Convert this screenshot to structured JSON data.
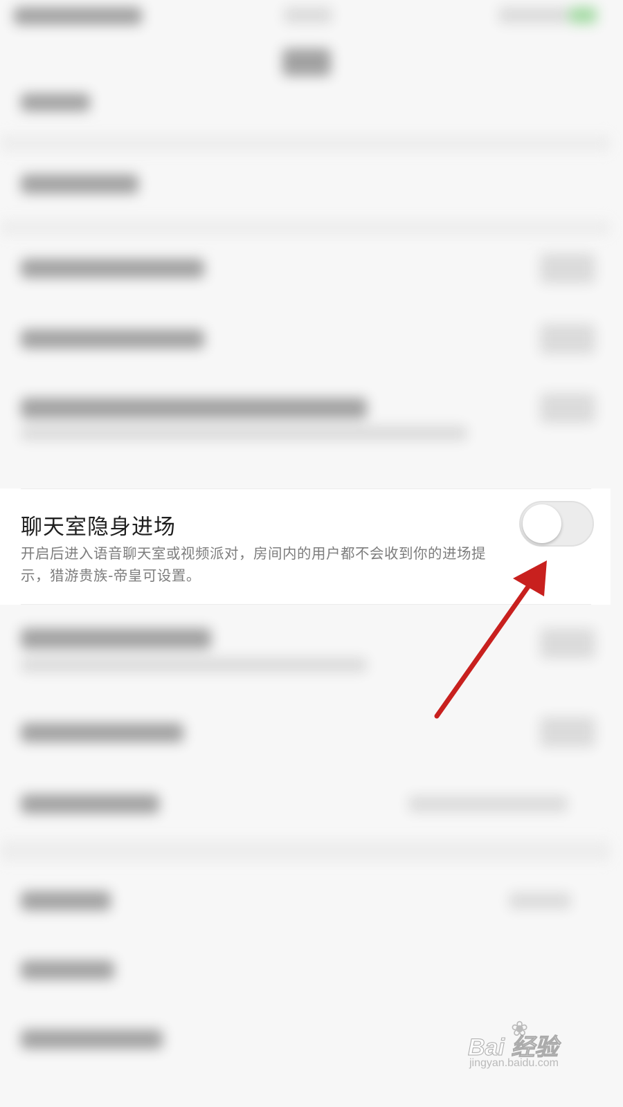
{
  "setting": {
    "title": "聊天室隐身进场",
    "description": "开启后进入语音聊天室或视频派对，房间内的用户都不会收到你的进场提示，猎游贵族-帝皇可设置。",
    "toggle_state": "off"
  },
  "annotation": {
    "arrow_color": "#c8201e",
    "target": "toggle"
  },
  "watermark": {
    "brand_text": "Bai 经验",
    "url": "jingyan.baidu.com"
  }
}
